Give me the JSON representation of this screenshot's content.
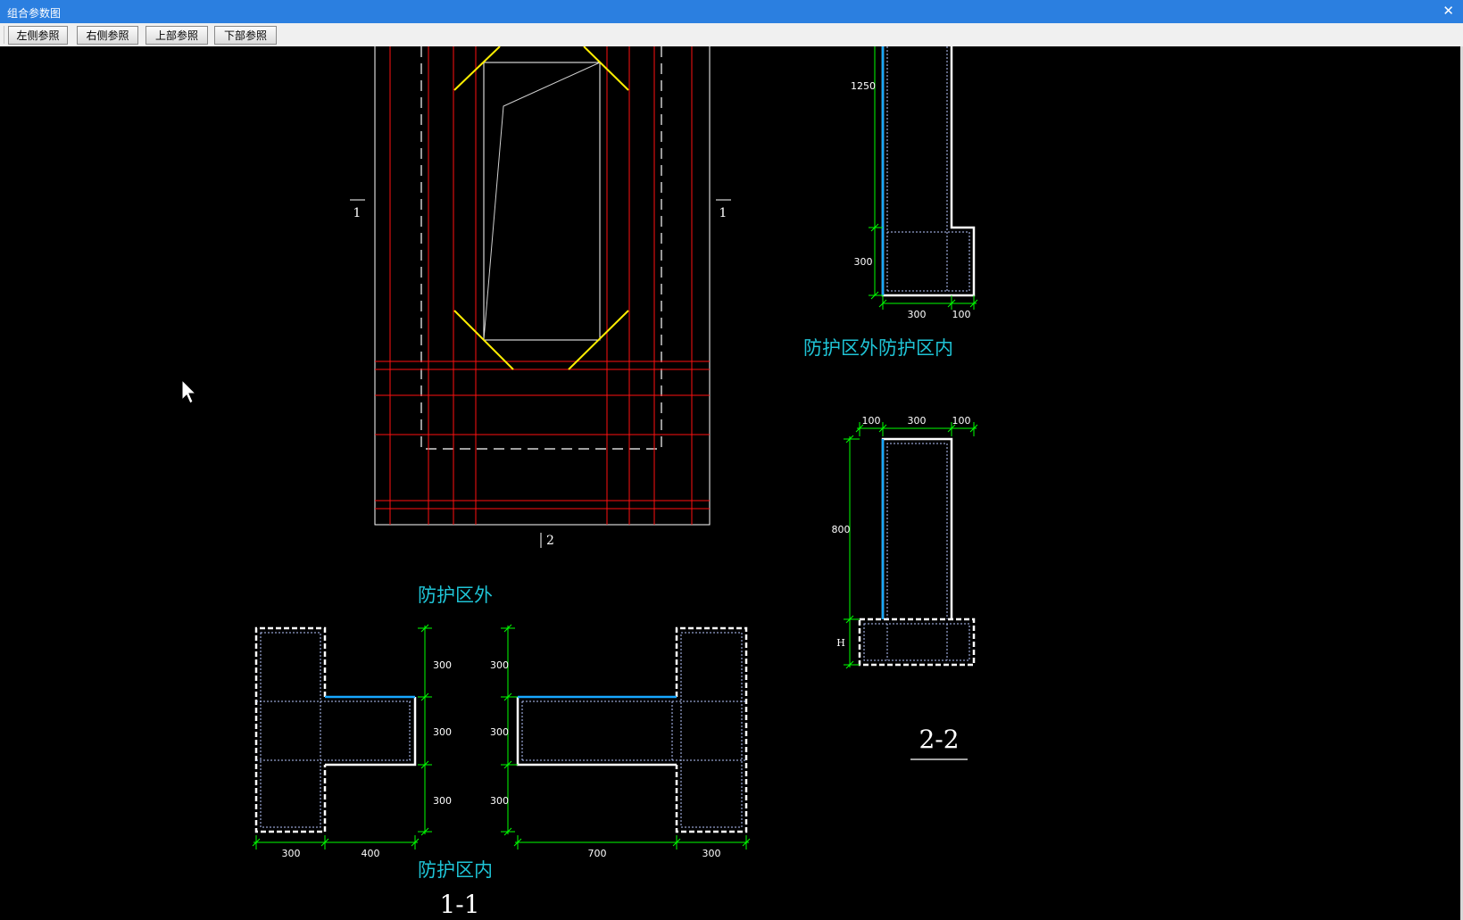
{
  "window": {
    "title": "组合参数图",
    "close_glyph": "✕"
  },
  "toolbar": {
    "buttons": [
      "左侧参照",
      "右侧参照",
      "上部参照",
      "下部参照"
    ]
  },
  "drawing": {
    "section_marks": {
      "left": "1",
      "right": "1",
      "bottom": "2"
    },
    "elevation_dims": {
      "top": "1250",
      "bottom": "300",
      "bottom_left": "300",
      "bottom_right": "100"
    },
    "elevation_label": "防护区外防护区内",
    "section22_dims": {
      "top_left": "100",
      "top_mid": "300",
      "top_right": "100",
      "height": "800",
      "base": "H"
    },
    "section22_title": "2-2",
    "section11": {
      "label_outside": "防护区外",
      "label_inside": "防护区内",
      "title": "1-1",
      "left_vertical": [
        "300",
        "300",
        "300"
      ],
      "left_horizontal": [
        "300",
        "400"
      ],
      "right_vertical": [
        "300",
        "300",
        "300"
      ],
      "right_horizontal": [
        "700",
        "300"
      ]
    }
  },
  "colors": {
    "title_bar": "#2b7fe0",
    "label_cyan": "#1fc4d6",
    "dimension": "#00ff00",
    "rebar": "#ff0000",
    "chamfer": "#ffff00",
    "wall_edge": "#17a8ff"
  }
}
